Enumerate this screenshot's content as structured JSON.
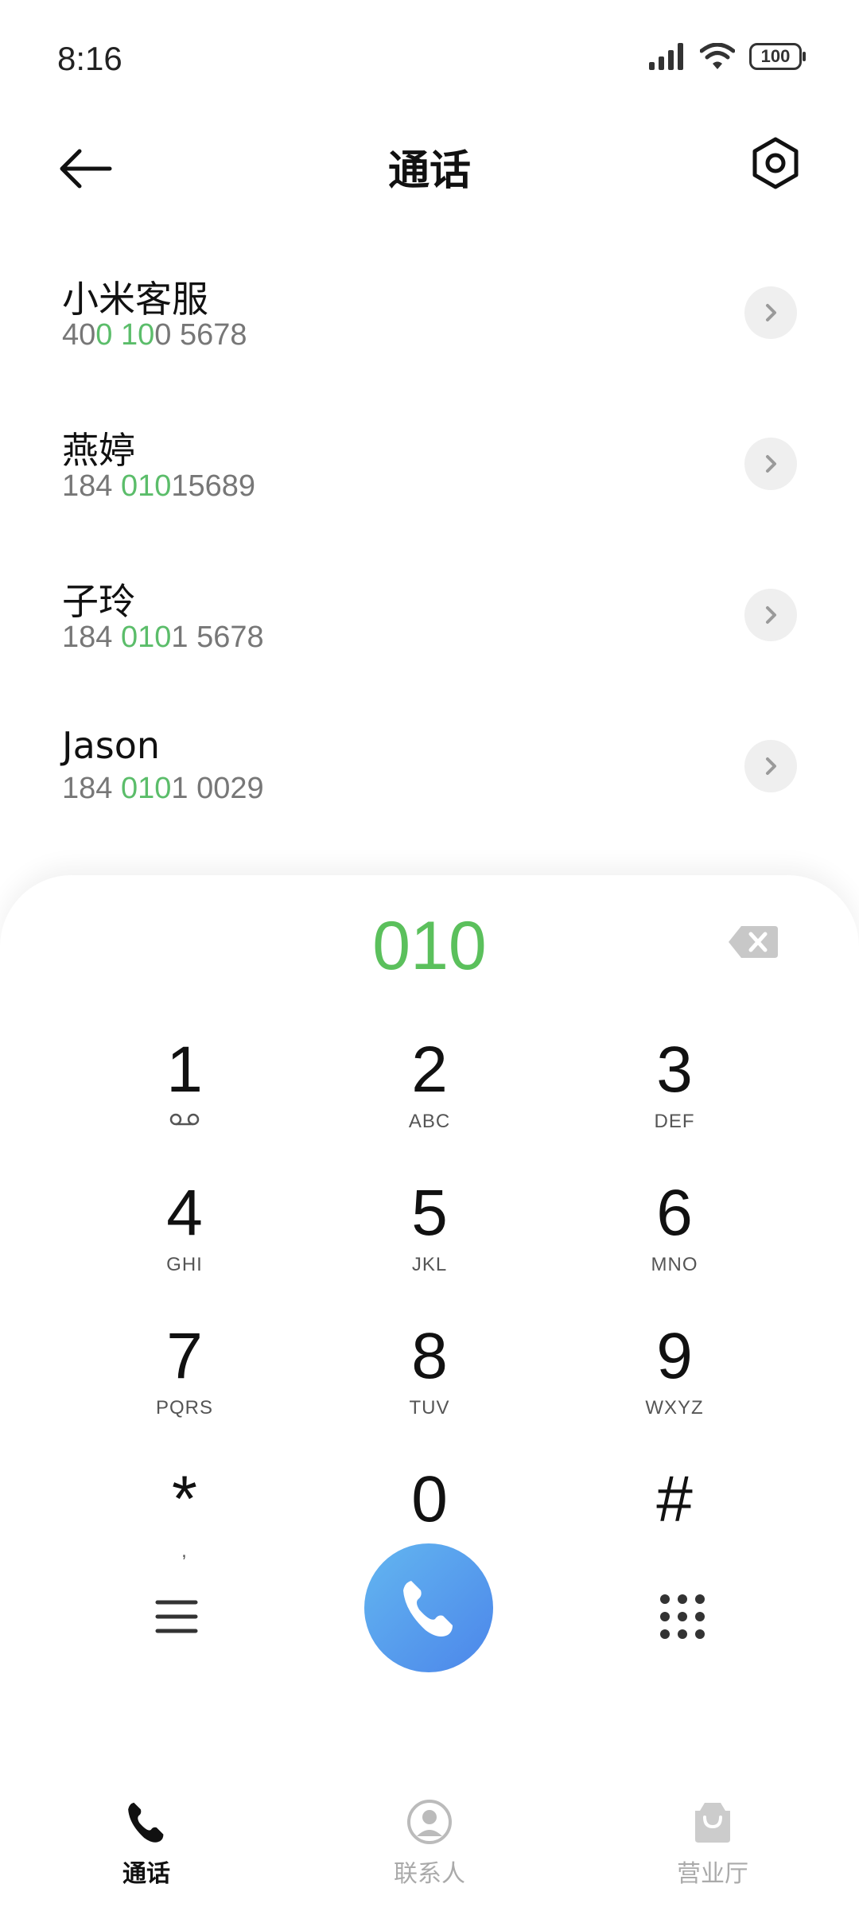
{
  "status": {
    "time": "8:16",
    "battery": "100"
  },
  "header": {
    "title": "通话"
  },
  "results": [
    {
      "name": "小米客服",
      "number_parts": [
        {
          "t": "40",
          "h": false
        },
        {
          "t": "0",
          "h": true
        },
        {
          "t": " ",
          "h": false
        },
        {
          "t": "10",
          "h": true
        },
        {
          "t": "0 5678",
          "h": false
        }
      ]
    },
    {
      "name": "燕婷",
      "number_parts": [
        {
          "t": "184 ",
          "h": false
        },
        {
          "t": "010",
          "h": true
        },
        {
          "t": "15689",
          "h": false
        }
      ]
    },
    {
      "name": "子玲",
      "number_parts": [
        {
          "t": "184 ",
          "h": false
        },
        {
          "t": "010",
          "h": true
        },
        {
          "t": "1 5678",
          "h": false
        }
      ]
    },
    {
      "name": "Jason",
      "number_parts": [
        {
          "t": "184 ",
          "h": false
        },
        {
          "t": "010",
          "h": true
        },
        {
          "t": "1 0029",
          "h": false
        }
      ]
    }
  ],
  "dial": {
    "input": "010"
  },
  "keys": [
    {
      "digit": "1",
      "letters": ""
    },
    {
      "digit": "2",
      "letters": "ABC"
    },
    {
      "digit": "3",
      "letters": "DEF"
    },
    {
      "digit": "4",
      "letters": "GHI"
    },
    {
      "digit": "5",
      "letters": "JKL"
    },
    {
      "digit": "6",
      "letters": "MNO"
    },
    {
      "digit": "7",
      "letters": "PQRS"
    },
    {
      "digit": "8",
      "letters": "TUV"
    },
    {
      "digit": "9",
      "letters": "WXYZ"
    },
    {
      "digit": "*",
      "letters": ","
    },
    {
      "digit": "0",
      "letters": "+"
    },
    {
      "digit": "#",
      "letters": ""
    }
  ],
  "nav": [
    {
      "label": "通话",
      "icon": "phone-icon"
    },
    {
      "label": "联系人",
      "icon": "person-icon"
    },
    {
      "label": "营业厅",
      "icon": "shopping-bag-icon"
    }
  ],
  "colors": {
    "highlight": "#5bbd6a",
    "call_button": "#4c86ea",
    "dial_text": "#5bc05c"
  }
}
